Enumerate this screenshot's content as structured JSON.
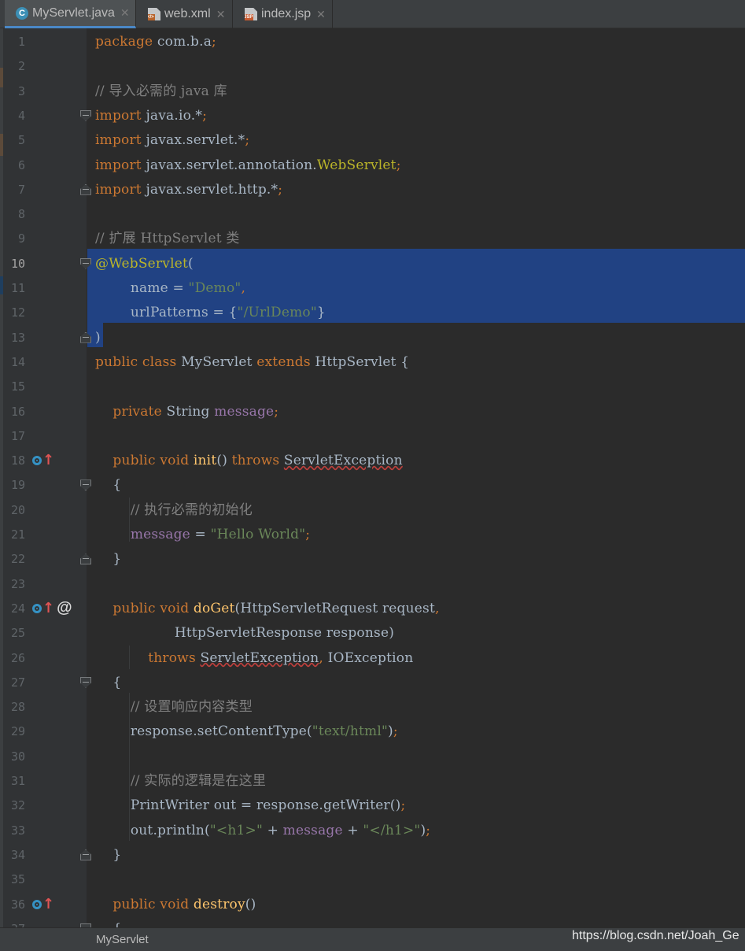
{
  "tabs": [
    {
      "label": "MyServlet.java",
      "icon": "java-class-icon",
      "active": true
    },
    {
      "label": "web.xml",
      "icon": "xml-file-icon",
      "active": false
    },
    {
      "label": "index.jsp",
      "icon": "jsp-file-icon",
      "active": false
    }
  ],
  "tab_close_glyph": "✕",
  "file_badges": {
    "xml": "</>",
    "jsp": "JSP"
  },
  "class_badge": "C",
  "colors": {
    "background": "#2b2b2b",
    "gutter": "#313335",
    "selection": "#214283",
    "keyword": "#cc7832",
    "string": "#6a8759",
    "comment": "#808080",
    "annotation": "#bbb529",
    "field": "#9876aa",
    "method": "#ffc66d"
  },
  "code_lines": [
    [
      [
        "package ",
        "k"
      ],
      [
        "com.b.a",
        "t"
      ],
      [
        ";",
        "k"
      ]
    ],
    [],
    [
      [
        "// 导入必需的 java 库",
        "c"
      ]
    ],
    [
      [
        "import ",
        "k"
      ],
      [
        "java.io.*",
        "t"
      ],
      [
        ";",
        "k"
      ]
    ],
    [
      [
        "import ",
        "k"
      ],
      [
        "javax.servlet.*",
        "t"
      ],
      [
        ";",
        "k"
      ]
    ],
    [
      [
        "import ",
        "k"
      ],
      [
        "javax.servlet.annotation.",
        "t"
      ],
      [
        "WebServlet",
        "a"
      ],
      [
        ";",
        "k"
      ]
    ],
    [
      [
        "import ",
        "k"
      ],
      [
        "javax.servlet.http.*",
        "t"
      ],
      [
        ";",
        "k"
      ]
    ],
    [],
    [
      [
        "// 扩展 HttpServlet 类",
        "c"
      ]
    ],
    [
      [
        "@WebServlet",
        "a"
      ],
      [
        "(",
        "t"
      ]
    ],
    [
      [
        "        name = ",
        "t"
      ],
      [
        "\"Demo\"",
        "s"
      ],
      [
        ",",
        "k"
      ]
    ],
    [
      [
        "        urlPatterns = {",
        "t"
      ],
      [
        "\"/UrlDemo\"",
        "s"
      ],
      [
        "}",
        "t"
      ]
    ],
    [
      [
        ")",
        "t"
      ]
    ],
    [
      [
        "public class ",
        "k"
      ],
      [
        "MyServlet ",
        "t"
      ],
      [
        "extends ",
        "k"
      ],
      [
        "HttpServlet {",
        "t"
      ]
    ],
    [],
    [
      [
        "    private ",
        "k"
      ],
      [
        "String ",
        "t"
      ],
      [
        "message",
        "f"
      ],
      [
        ";",
        "k"
      ]
    ],
    [],
    [
      [
        "    public void ",
        "k"
      ],
      [
        "init",
        "m"
      ],
      [
        "() ",
        "t"
      ],
      [
        "throws ",
        "k"
      ],
      [
        "ServletException",
        "u"
      ]
    ],
    [
      [
        "    {",
        "t"
      ]
    ],
    [
      [
        "        // 执行必需的初始化",
        "c"
      ]
    ],
    [
      [
        "        message",
        "f"
      ],
      [
        " = ",
        "t"
      ],
      [
        "\"Hello World\"",
        "s"
      ],
      [
        ";",
        "k"
      ]
    ],
    [
      [
        "    }",
        "t"
      ]
    ],
    [],
    [
      [
        "    public void ",
        "k"
      ],
      [
        "doGet",
        "m"
      ],
      [
        "(HttpServletRequest request",
        "t"
      ],
      [
        ",",
        "k"
      ]
    ],
    [
      [
        "                  HttpServletResponse response)",
        "t"
      ]
    ],
    [
      [
        "            throws ",
        "k"
      ],
      [
        "ServletException",
        "u"
      ],
      [
        ", ",
        "k"
      ],
      [
        "IOException",
        "t"
      ]
    ],
    [
      [
        "    {",
        "t"
      ]
    ],
    [
      [
        "        // 设置响应内容类型",
        "c"
      ]
    ],
    [
      [
        "        response.setContentType(",
        "t"
      ],
      [
        "\"text/html\"",
        "s"
      ],
      [
        ")",
        "t"
      ],
      [
        ";",
        "k"
      ]
    ],
    [],
    [
      [
        "        // 实际的逻辑是在这里",
        "c"
      ]
    ],
    [
      [
        "        PrintWriter out = response.getWriter()",
        "t"
      ],
      [
        ";",
        "k"
      ]
    ],
    [
      [
        "        out.println(",
        "t"
      ],
      [
        "\"<h1>\"",
        "s"
      ],
      [
        " + ",
        "t"
      ],
      [
        "message",
        "f"
      ],
      [
        " + ",
        "t"
      ],
      [
        "\"</h1>\"",
        "s"
      ],
      [
        ")",
        "t"
      ],
      [
        ";",
        "k"
      ]
    ],
    [
      [
        "    }",
        "t"
      ]
    ],
    [],
    [
      [
        "    public void ",
        "k"
      ],
      [
        "destroy",
        "m"
      ],
      [
        "()",
        "t"
      ]
    ],
    [
      [
        "    {",
        "t"
      ]
    ]
  ],
  "current_line": 10,
  "status": {
    "class_name": "MyServlet"
  },
  "watermark": "https://blog.csdn.net/Joah_Ge"
}
